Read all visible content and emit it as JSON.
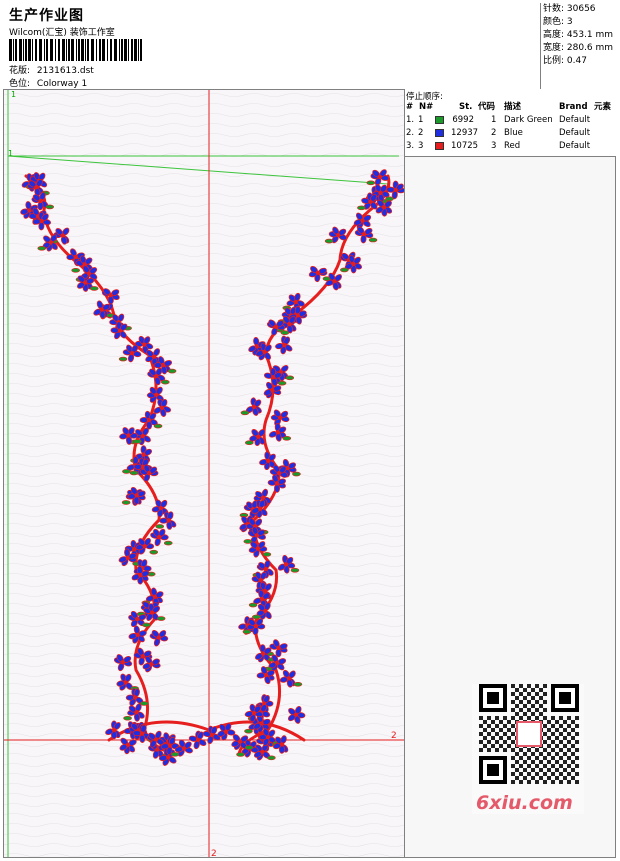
{
  "header": {
    "title": "生产作业图",
    "company": "Wilcom(汇宝) 装饰工作室",
    "design_label": "花版:",
    "design_value": "2131613.dst",
    "color_label": "色位:",
    "color_value": "Colorway 1"
  },
  "info": {
    "stitches": "针数: 30656",
    "colors": "颜色: 3",
    "height": "高度: 453.1 mm",
    "width": "宽度: 280.6 mm",
    "scale": "比例: 0.47"
  },
  "stop_sequence": {
    "title": "停止顺序:",
    "headers": [
      "#",
      "N#",
      "St.",
      "代码",
      "描述",
      "Brand",
      "元素"
    ],
    "rows": [
      {
        "idx": "1.",
        "n": "1",
        "st": "6992",
        "code": "1",
        "desc": "Dark Green",
        "brand": "Default",
        "color": "#1a9a2a"
      },
      {
        "idx": "2.",
        "n": "2",
        "st": "12937",
        "code": "2",
        "desc": "Blue",
        "brand": "Default",
        "color": "#1f2ee0"
      },
      {
        "idx": "3.",
        "n": "3",
        "st": "10725",
        "code": "3",
        "desc": "Red",
        "brand": "Default",
        "color": "#e61e1e"
      }
    ]
  },
  "markers": {
    "green_top": "1",
    "green_left": "1",
    "red_right": "2",
    "red_bottom": "2"
  },
  "watermark": {
    "text": "6xiu.com",
    "stamp": "刺绣图库"
  }
}
